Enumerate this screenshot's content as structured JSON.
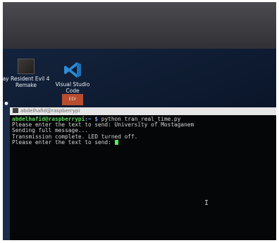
{
  "desktop": {
    "icons": [
      {
        "label": "ay Resident Evil 4 Remake"
      },
      {
        "label": "Visual Studio Code"
      },
      {
        "label": "EDr"
      }
    ]
  },
  "terminal": {
    "title": "abdelhafid@raspberrypi",
    "lines": [
      {
        "prompt": "abdelhafid@raspberrypi",
        "path": ":~ $",
        "text": " python tran_real_time.py"
      },
      {
        "text": "Please enter the text to send: University of Mostaganem"
      },
      {
        "text": "Sending full message..."
      },
      {
        "text": "Transmission complete. LED turned off."
      },
      {
        "text": "Please enter the text to send: "
      }
    ]
  },
  "colors": {
    "prompt": "#58d45a",
    "path": "#6fa3ff",
    "cursor": "#4ff04f",
    "desktop_bg": "#0b1c33"
  }
}
